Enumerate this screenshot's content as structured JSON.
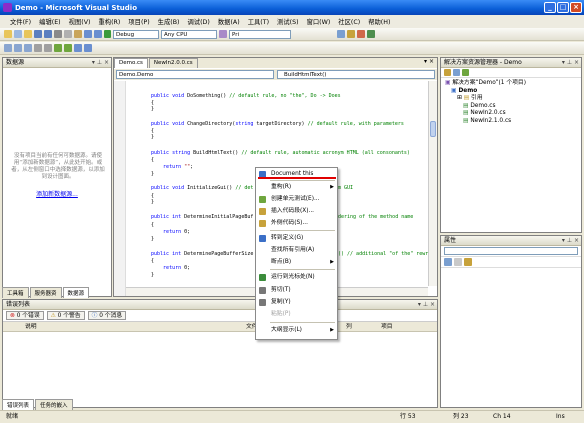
{
  "window": {
    "title": "Demo - Microsoft Visual Studio",
    "min": "_",
    "max": "□",
    "close": "×"
  },
  "menubar": [
    "文件(F)",
    "编辑(E)",
    "视图(V)",
    "重构(R)",
    "项目(P)",
    "生成(B)",
    "调试(D)",
    "数据(A)",
    "工具(T)",
    "测试(S)",
    "窗口(W)",
    "社区(C)",
    "帮助(H)"
  ],
  "toolbar": {
    "config": "Debug",
    "platform": "Any CPU",
    "find": "Pri"
  },
  "left_panel": {
    "title": "数据源",
    "message": [
      "没有项目当前有任何可数据源。请使用“添加新数据源”，从此处开始。或者，从左侧窗口中选择数据源，以添加到设计图面。"
    ],
    "link": "添加新数据源...",
    "tabs": [
      "工具箱",
      "服务器资",
      "数据源"
    ]
  },
  "editor": {
    "tabs": [
      "Demo.cs",
      "NewIn2.0.0.cs"
    ],
    "class_dropdown": "Demo.Demo",
    "member_dropdown": "BuildHtmlText()",
    "lines": [
      {
        "t": "public void DoSomething() // default rule, no \"the\", Do -> Does",
        "kind": "sig"
      },
      {
        "t": "{",
        "kind": "plain"
      },
      {
        "t": "}",
        "kind": "plain"
      },
      {
        "t": "public void ChangeDirectory(string targetDirectory) // default rule, with parameters",
        "kind": "sig"
      },
      {
        "t": "{",
        "kind": "plain"
      },
      {
        "t": "}",
        "kind": "plain"
      },
      {
        "t": "public string BuildHtmlText() // default rule, automatic acronym HTML (all consonants)",
        "kind": "sig"
      },
      {
        "t": "{",
        "kind": "plain"
      },
      {
        "t": "    return \"\";",
        "kind": "ret"
      },
      {
        "t": "}",
        "kind": "plain"
      },
      {
        "t": "public void InitializeGui() // det",
        "kind": "sig"
      },
      {
        "t": "{",
        "kind": "plain"
      },
      {
        "t": "}",
        "kind": "plain"
      },
      {
        "t": "public int DetermineInitialPageBuf",
        "kind": "sig"
      },
      {
        "t": "{",
        "kind": "plain"
      },
      {
        "t": "    return 0;",
        "kind": "ret"
      },
      {
        "t": "}",
        "kind": "plain"
      },
      {
        "t": "public int DeterminePageBufferSize",
        "kind": "sig"
      },
      {
        "t": "{",
        "kind": "plain"
      },
      {
        "t": "    return 0;",
        "kind": "ret"
      },
      {
        "t": "}",
        "kind": "plain"
      }
    ],
    "right_fragments": [
      "nym GUI",
      "dering of the method name",
      "() // additional \"of the\" rewr"
    ]
  },
  "context_menu": [
    {
      "label": "Document this",
      "icon": "#3B6FC7",
      "arrow": false,
      "enabled": true,
      "highlight": true
    },
    {
      "label": "重构(R)",
      "icon": "",
      "arrow": true,
      "enabled": true
    },
    {
      "label": "创建单元测试(E)...",
      "icon": "#6FA63E",
      "arrow": false,
      "enabled": true
    },
    {
      "label": "插入代码段(X)...",
      "icon": "#C7A23B",
      "arrow": false,
      "enabled": true
    },
    {
      "label": "外侧代码(S)...",
      "icon": "#C7A23B",
      "arrow": false,
      "enabled": true
    },
    {
      "label": "转到定义(G)",
      "icon": "#3B6FC7",
      "arrow": false,
      "enabled": true
    },
    {
      "label": "查找所有引用(A)",
      "icon": "",
      "arrow": false,
      "enabled": true
    },
    {
      "label": "断点(B)",
      "icon": "",
      "arrow": true,
      "enabled": true
    },
    {
      "label": "运行到光标处(N)",
      "icon": "#3B8C3B",
      "arrow": false,
      "enabled": true
    },
    {
      "label": "剪切(T)",
      "icon": "#777777",
      "arrow": false,
      "enabled": true
    },
    {
      "label": "复制(Y)",
      "icon": "#777777",
      "arrow": false,
      "enabled": true
    },
    {
      "label": "粘贴(P)",
      "icon": "",
      "arrow": false,
      "enabled": false
    },
    {
      "label": "大纲显示(L)",
      "icon": "",
      "arrow": true,
      "enabled": true
    }
  ],
  "solution": {
    "title": "解决方案资源管理器 - Demo",
    "root": "解决方案“Demo”(1 个项目)",
    "project": "Demo",
    "items": [
      "引用",
      "Demo.cs",
      "NewIn2.0.cs",
      "NewIn2.1.0.cs"
    ]
  },
  "properties": {
    "title": "属性"
  },
  "errors": {
    "title": "错误列表",
    "filters": [
      "0 个错误",
      "0 个警告",
      "0 个消息"
    ],
    "columns": [
      "说明",
      "文件",
      "行",
      "列",
      "项目"
    ],
    "tabs": [
      "错误列表",
      "任务的嵌入"
    ]
  },
  "status": {
    "ready": "就绪",
    "line": "行 53",
    "col": "列 23",
    "ch": "Ch 14",
    "ins": "Ins"
  },
  "colors": {
    "keyword": "#0000FF",
    "comment": "#008000",
    "highlight_underline": "#E00000"
  }
}
